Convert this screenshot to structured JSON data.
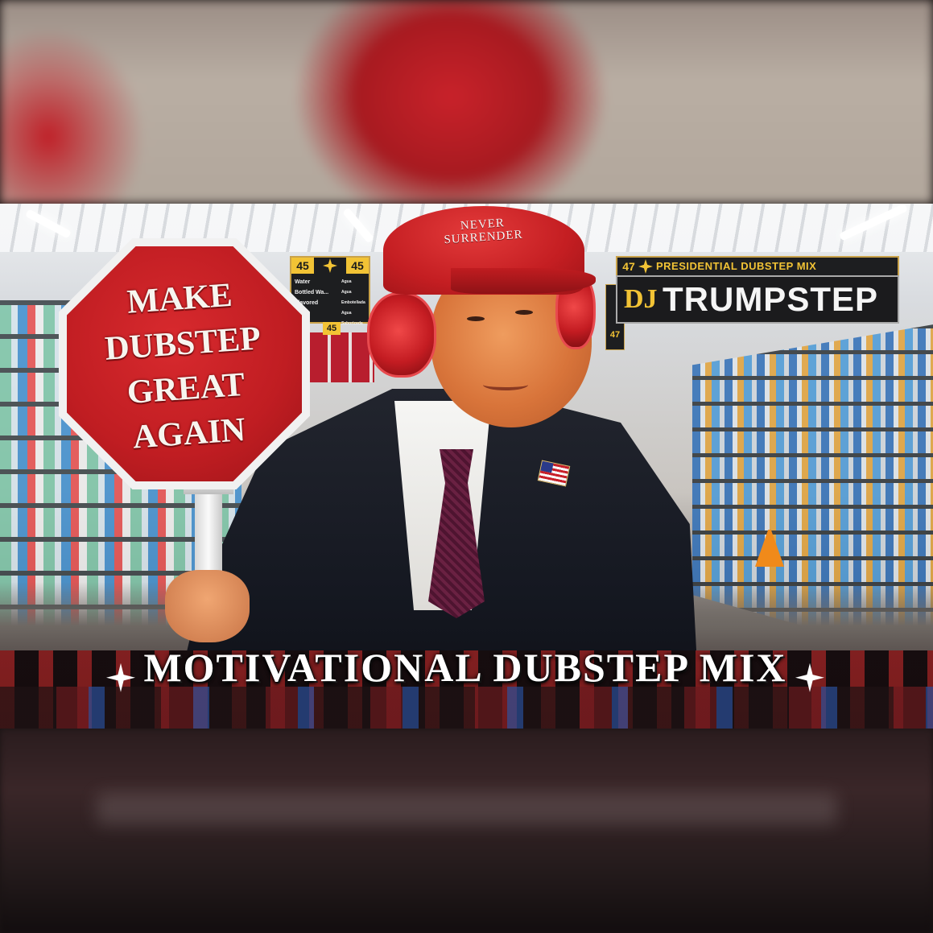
{
  "stop_sign": {
    "line1": "MAKE",
    "line2": "DUBSTEP",
    "line3": "GREAT",
    "line4": "AGAIN"
  },
  "cap": {
    "line1": "NEVER",
    "line2": "SURRENDER"
  },
  "banner": {
    "aisle_number": "47",
    "subtitle": "PRESIDENTIAL DUBSTEP MIX",
    "logo": "DJ",
    "title": "TRUMPSTEP"
  },
  "aisle_sign_left": {
    "number_left": "45",
    "number_right": "45",
    "rows": [
      "Water",
      "Bottled Wa...",
      "Flavored Wa..."
    ],
    "rows_es": [
      "Agua",
      "Agua Embotellada",
      "Agua Saborizada"
    ],
    "lower_number": "45"
  },
  "side_aisle_number": "47",
  "title": {
    "text": "MOTIVATIONAL DUBSTEP MIX",
    "star_left": "star-icon",
    "star_right": "star-icon"
  },
  "colors": {
    "sign_red": "#c01d22",
    "cap_red": "#c41e22",
    "banner_gold": "#f2c335",
    "banner_dark": "#1b1b1d"
  }
}
